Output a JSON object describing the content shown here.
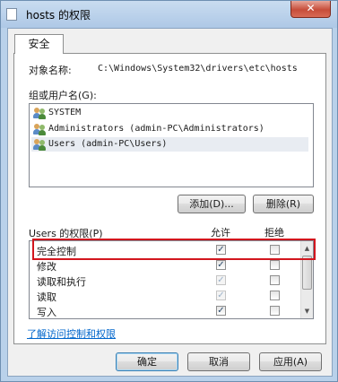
{
  "window": {
    "title": "hosts 的权限",
    "close_glyph": "✕"
  },
  "tabs": [
    {
      "label": "安全"
    }
  ],
  "object": {
    "label": "对象名称:",
    "value": "C:\\Windows\\System32\\drivers\\etc\\hosts"
  },
  "groups": {
    "label": "组或用户名(G):",
    "items": [
      {
        "name": "SYSTEM",
        "icon": "users-icon",
        "selected": false
      },
      {
        "name": "Administrators (admin-PC\\Administrators)",
        "icon": "users-icon",
        "selected": false
      },
      {
        "name": "Users (admin-PC\\Users)",
        "icon": "users-icon",
        "selected": true
      }
    ],
    "add_label": "添加(D)...",
    "remove_label": "删除(R)"
  },
  "permissions": {
    "label": "Users 的权限(P)",
    "allow_header": "允许",
    "deny_header": "拒绝",
    "rows": [
      {
        "name": "完全控制",
        "allow": true,
        "allow_disabled": false,
        "deny": false
      },
      {
        "name": "修改",
        "allow": true,
        "allow_disabled": false,
        "deny": false
      },
      {
        "name": "读取和执行",
        "allow": true,
        "allow_disabled": true,
        "deny": false
      },
      {
        "name": "读取",
        "allow": true,
        "allow_disabled": true,
        "deny": false
      },
      {
        "name": "写入",
        "allow": true,
        "allow_disabled": false,
        "deny": false
      }
    ]
  },
  "link_label": "了解访问控制和权限",
  "buttons": {
    "ok": "确定",
    "cancel": "取消",
    "apply": "应用(A)"
  },
  "colors": {
    "highlight": "#d2161e",
    "link": "#0066cc"
  }
}
